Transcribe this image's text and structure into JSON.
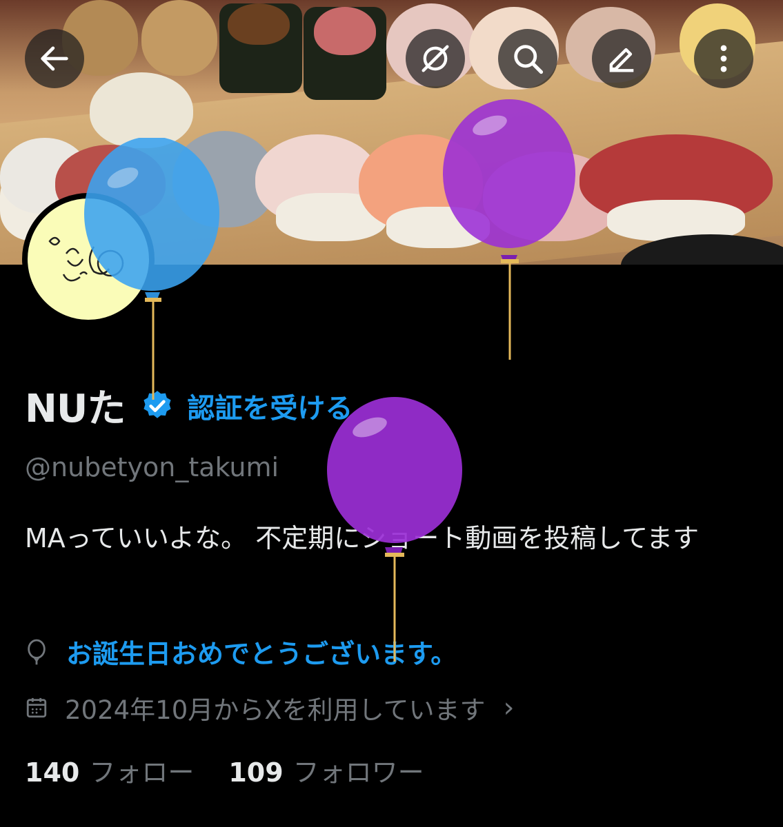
{
  "header": {
    "back_icon": "arrow-left-icon",
    "actions": [
      "grok-icon",
      "search-icon",
      "edit-icon",
      "more-vertical-icon"
    ]
  },
  "profile": {
    "display_name": "NUた",
    "verify_link": "認証を受ける",
    "handle": "@nubetyon_takumi",
    "bio": "MAっていいよな。 不定期にショート動画を投稿してます",
    "birthday": "お誕生日おめでとうございます。",
    "joined": "2024年10月からXを利用しています",
    "following_count": "140",
    "following_label": "フォロー",
    "followers_count": "109",
    "followers_label": "フォロワー"
  },
  "colors": {
    "accent": "#1d9bf0",
    "text_primary": "#e7e9ea",
    "text_secondary": "#71767b",
    "background": "#000000",
    "avatar_bg": "#fafcb8",
    "balloon_blue": "#3aa3f0",
    "balloon_purple": "#9b2fd6"
  }
}
